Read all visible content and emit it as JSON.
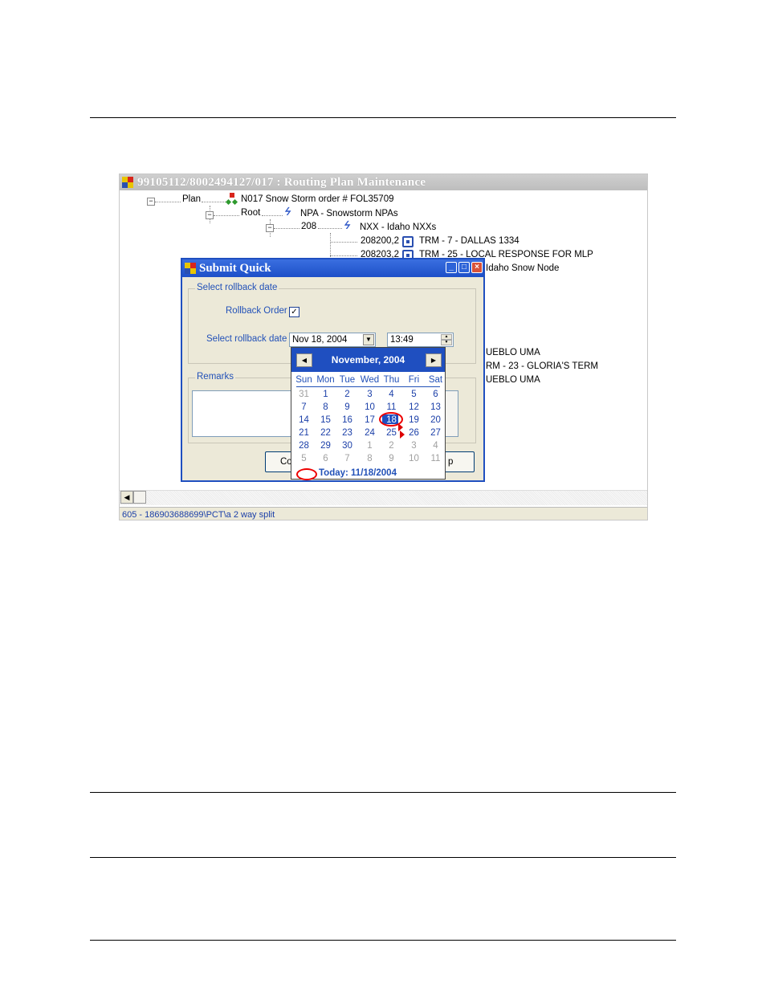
{
  "window": {
    "title": "99105112/8002494127/017 : Routing Plan Maintenance",
    "status": "605 - 186903688699\\PCT\\a 2 way split"
  },
  "tree": {
    "plan_label": "Plan",
    "plan_node": "N017   Snow Storm  order #  FOL35709",
    "root_label": "Root",
    "npa_node": "NPA - Snowstorm NPAs",
    "nxx_label": "208",
    "nxx_node": "NXX - Idaho NXXs",
    "row1_code": "208200,2",
    "row1_text": "TRM - 7 - DALLAS 1334",
    "row2_code": "208203,2",
    "row2_text": "TRM - 25 - LOCAL RESPONSE FOR MLP",
    "row3_text": "Idaho Snow Node",
    "row4_text": "UEBLO UMA",
    "row5_text": "RM - 23 - GLORIA'S TERM",
    "row6_text": "UEBLO UMA"
  },
  "dialog": {
    "title": "Submit Quick",
    "group1_legend": "Select rollback date",
    "rollback_order_label": "Rollback Order",
    "rollback_checked": "✓",
    "select_date_label": "Select rollback date",
    "date_value": "Nov 18, 2004",
    "time_value": "13:49",
    "remarks_legend": "Remarks",
    "btn_left_label": "Co",
    "btn_right_label": "p"
  },
  "calendar": {
    "title": "November, 2004",
    "dow": [
      "Sun",
      "Mon",
      "Tue",
      "Wed",
      "Thu",
      "Fri",
      "Sat"
    ],
    "weeks": [
      [
        "31",
        "1",
        "2",
        "3",
        "4",
        "5",
        "6"
      ],
      [
        "7",
        "8",
        "9",
        "10",
        "11",
        "12",
        "13"
      ],
      [
        "14",
        "15",
        "16",
        "17",
        "18",
        "19",
        "20"
      ],
      [
        "21",
        "22",
        "23",
        "24",
        "25",
        "26",
        "27"
      ],
      [
        "28",
        "29",
        "30",
        "1",
        "2",
        "3",
        "4"
      ],
      [
        "5",
        "6",
        "7",
        "8",
        "9",
        "10",
        "11"
      ]
    ],
    "today": "Today: 11/18/2004",
    "selected_day": "18",
    "accent": "#1f4fc0"
  }
}
